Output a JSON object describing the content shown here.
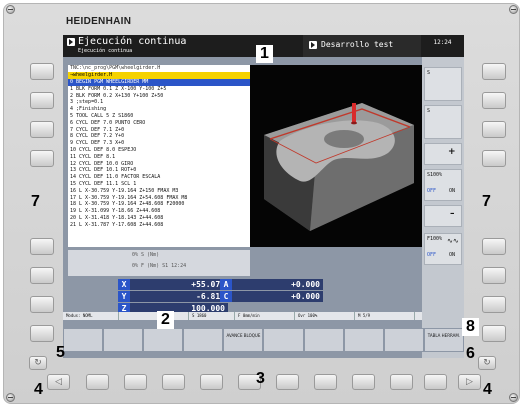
{
  "brand": "HEIDENHAIN",
  "callouts": {
    "c1": "1",
    "c2": "2",
    "c3": "3",
    "c4a": "4",
    "c4b": "4",
    "c5": "5",
    "c6": "6",
    "c7a": "7",
    "c7b": "7",
    "c8": "8"
  },
  "screen": {
    "mode_title": "Ejecución continua",
    "mode_subtitle": "Ejecución continua",
    "secondary_mode": "Desarrollo test",
    "clock": "12:24"
  },
  "program": {
    "path": "TNC:\\nc_prog\\PGM\\wheelgirder.H",
    "file": "→wheelgirder.H",
    "lines": [
      "0  BEGIN PGM WHEELGIRDER MM",
      "1  BLK FORM 0.1 Z X-100 Y-100 Z+5",
      "2  BLK FORM 0.2 X+130 Y+100 Z+50",
      "3  ;step=0.1",
      "4  ;Finishing",
      "5  TOOL CALL 5 Z S1860",
      "6  CYCL DEF 7.0 PUNTO CERO",
      "7  CYCL DEF 7.1 Z+0",
      "8  CYCL DEF 7.2 Y+0",
      "9  CYCL DEF 7.3 X+0",
      "10 CYCL DEF 8.0 ESPEJO",
      "11 CYCL DEF 8.1",
      "12 CYCL DEF 10.0 GIRO",
      "13 CYCL DEF 10.1 ROT+0",
      "14 CYCL DEF 11.0 FACTOR ESCALA",
      "15 CYCL DEF 11.1 SCL 1",
      "16 L  X-30.759 Y-19.164 Z+150 FMAX M3",
      "17 L  X-30.759 Y-19.164 Z+54.608 FMAX M8",
      "18 L  X-30.759 Y-19.164 Z+48.608 F20000",
      "19 L  X-31.099 Y-18.66 Z+44.608",
      "20 L  X-31.418 Y-18.143 Z+44.608",
      "21 L  X-31.787 Y-17.608 Z+44.608"
    ]
  },
  "status": {
    "row1": "0% S (Nm)",
    "row2": "0% F (Nm)  S1  12:24"
  },
  "positions": [
    {
      "axis": "X",
      "value": "+55.076"
    },
    {
      "axis": "Y",
      "value": "-6.817"
    },
    {
      "axis": "Z",
      "value": "100.000"
    }
  ],
  "positions_right": [
    {
      "axis": "A",
      "value": "+0.000"
    },
    {
      "axis": "C",
      "value": "+0.000"
    }
  ],
  "statusbar": {
    "mode": "Modus: NOML",
    "s": "S 1860",
    "f": "F 0mm/min",
    "ovr": "Ovr 100%",
    "m": "M 5/9"
  },
  "softkeys": [
    "",
    "",
    "",
    "",
    "AVANCE BLOQUE",
    "",
    "",
    "",
    "",
    "TABLA HERRAM."
  ],
  "right_labels": {
    "s_override": "S100%",
    "f_override": "F100%",
    "off": "OFF",
    "on": "ON"
  }
}
